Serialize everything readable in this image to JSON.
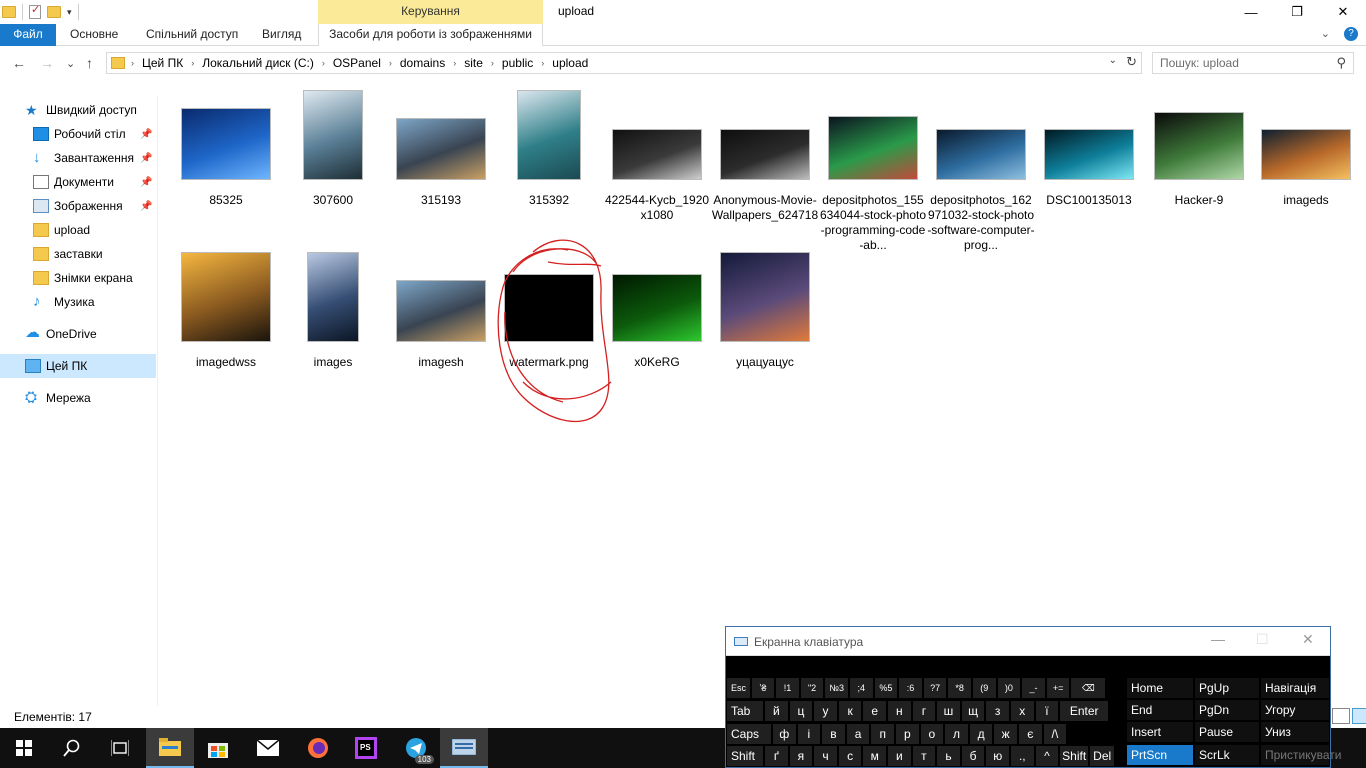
{
  "window": {
    "title": "upload",
    "minimize_icon": "—",
    "maximize_icon": "❐",
    "close_icon": "✕"
  },
  "qat": {
    "dropdown": "▾"
  },
  "ribbon": {
    "context_header": "Керування",
    "tabs": [
      "Файл",
      "Основне",
      "Спільний доступ",
      "Вигляд",
      "Засоби для роботи із зображеннями"
    ],
    "collapse": "⌄",
    "help": "?"
  },
  "nav": {
    "back": "←",
    "forward": "→",
    "recent": "⌄",
    "up": "↑"
  },
  "address": {
    "breadcrumbs": [
      "Цей ПК",
      "Локальний диск (C:)",
      "OSPanel",
      "domains",
      "site",
      "public",
      "upload"
    ],
    "separator": "›",
    "dropdown": "⌄",
    "refresh": "↻"
  },
  "search": {
    "placeholder": "Пошук: upload",
    "icon": "⚲"
  },
  "sidebar": {
    "items": [
      {
        "label": "Швидкий доступ",
        "icon": "star-icon",
        "pinned": false
      },
      {
        "label": "Робочий стіл",
        "icon": "desktop-icon",
        "pinned": true
      },
      {
        "label": "Завантаження",
        "icon": "download-icon",
        "pinned": true
      },
      {
        "label": "Документи",
        "icon": "documents-icon",
        "pinned": true
      },
      {
        "label": "Зображення",
        "icon": "pictures-icon",
        "pinned": true
      },
      {
        "label": "upload",
        "icon": "folder-icon",
        "pinned": false
      },
      {
        "label": "заставки",
        "icon": "folder-icon",
        "pinned": false
      },
      {
        "label": "Знімки екрана",
        "icon": "folder-icon",
        "pinned": false
      },
      {
        "label": "Музика",
        "icon": "music-icon",
        "pinned": false
      },
      {
        "label": "OneDrive",
        "icon": "cloud-icon",
        "pinned": false
      },
      {
        "label": "Цей ПК",
        "icon": "this-pc-icon",
        "pinned": false,
        "selected": true
      },
      {
        "label": "Мережа",
        "icon": "network-icon",
        "pinned": false
      }
    ],
    "pin_glyph": "📌"
  },
  "files": [
    {
      "name": "85325",
      "thumb_colors": [
        "#0a2a6e",
        "#1e66c8",
        "#6fb6ff"
      ]
    },
    {
      "name": "307600",
      "thumb_colors": [
        "#dfe9f0",
        "#5a7f96",
        "#1e2e36"
      ]
    },
    {
      "name": "315193",
      "thumb_colors": [
        "#7da6c8",
        "#394452",
        "#c9a064"
      ]
    },
    {
      "name": "315392",
      "thumb_colors": [
        "#dbe6ee",
        "#2f7f88",
        "#1b4a52"
      ]
    },
    {
      "name": "422544-Kycb_1920x1080",
      "thumb_colors": [
        "#111111",
        "#3a3a3a",
        "#cfcfcf"
      ]
    },
    {
      "name": "Anonymous-Movie-Wallpapers_624718",
      "thumb_colors": [
        "#0e0e0e",
        "#2c2c2c",
        "#bdbdbd"
      ]
    },
    {
      "name": "depositphotos_155634044-stock-photo-programming-code-ab...",
      "thumb_colors": [
        "#0b1420",
        "#2a9a4a",
        "#c24a3a"
      ]
    },
    {
      "name": "depositphotos_162971032-stock-photo-software-computer-prog...",
      "thumb_colors": [
        "#0a1a2c",
        "#2e6da0",
        "#8fc0e0"
      ]
    },
    {
      "name": "DSC100135013",
      "thumb_colors": [
        "#021a24",
        "#0e7f9a",
        "#7fe8f5"
      ]
    },
    {
      "name": "Hacker-9",
      "thumb_colors": [
        "#0a0a0a",
        "#3f7a3a",
        "#b0d8a8"
      ]
    },
    {
      "name": "imageds",
      "thumb_colors": [
        "#0e1f30",
        "#b8692a",
        "#f5c060"
      ]
    },
    {
      "name": "imagedwss",
      "thumb_colors": [
        "#f5b640",
        "#8a5a20",
        "#1a140c"
      ]
    },
    {
      "name": "images",
      "thumb_colors": [
        "#b9c9e2",
        "#364e74",
        "#0c1624"
      ]
    },
    {
      "name": "imagesh",
      "thumb_colors": [
        "#7da6c8",
        "#394452",
        "#c9a064"
      ]
    },
    {
      "name": "watermark.png",
      "thumb_colors": [
        "#000000",
        "#000000",
        "#000000"
      ]
    },
    {
      "name": "x0KeRG",
      "thumb_colors": [
        "#001800",
        "#0c5a0c",
        "#2ec82e"
      ]
    },
    {
      "name": "уцацуацус",
      "thumb_colors": [
        "#141a3a",
        "#5a4a7a",
        "#e07a3a"
      ]
    }
  ],
  "status": {
    "items_count": "Елементів: 17"
  },
  "taskbar": {
    "items": [
      "windows-start-icon",
      "search-icon",
      "task-view-icon",
      "file-explorer-icon",
      "store-icon",
      "mail-icon",
      "firefox-icon",
      "phpstorm-icon",
      "telegram-icon",
      "onscreen-keyboard-icon"
    ],
    "telegram_badge": "103",
    "ps_label": "PS"
  },
  "osk": {
    "title": "Екранна клавіатура",
    "minimize": "—",
    "maximize": "☐",
    "close": "✕",
    "rows": [
      [
        "Esc",
        "ʼ₴",
        "!1",
        "\"2",
        "№3",
        ";4",
        "%5",
        ":6",
        "?7",
        "*8",
        "(9",
        ")0",
        "_-",
        "+=",
        "⌫"
      ],
      [
        "Tab",
        "й",
        "ц",
        "у",
        "к",
        "е",
        "н",
        "г",
        "ш",
        "щ",
        "з",
        "х",
        "ї",
        "Enter"
      ],
      [
        "Caps",
        "ф",
        "і",
        "в",
        "а",
        "п",
        "р",
        "о",
        "л",
        "д",
        "ж",
        "є",
        "/\\"
      ],
      [
        "Shift",
        "ґ",
        "я",
        "ч",
        "с",
        "м",
        "и",
        "т",
        "ь",
        "б",
        "ю",
        ".,",
        "^",
        "Shift",
        "Del"
      ]
    ],
    "nav_keys": [
      [
        "Home",
        "PgUp",
        "Навігація"
      ],
      [
        "End",
        "PgDn",
        "Угору"
      ],
      [
        "Insert",
        "Pause",
        "Униз"
      ],
      [
        "PrtScn",
        "ScrLk",
        "Пристикувати"
      ]
    ]
  }
}
